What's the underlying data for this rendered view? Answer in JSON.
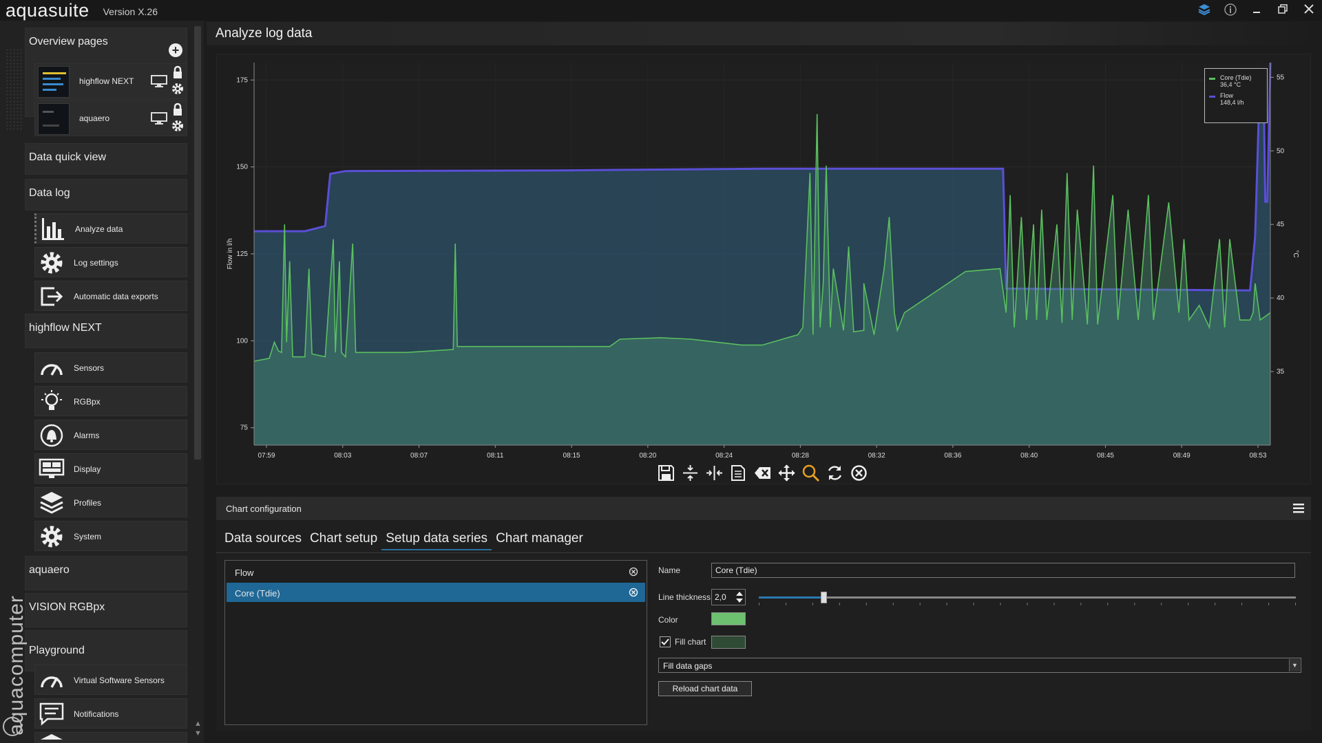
{
  "app": {
    "name": "aquasuite",
    "version": "Version X.26"
  },
  "brand": {
    "vertical": "aquacomputer"
  },
  "window_controls": {
    "layers_icon": "layers-icon",
    "info_icon": "info-icon"
  },
  "sidebar": {
    "overview_title": "Overview pages",
    "overview_pages": [
      {
        "label": "highflow NEXT"
      },
      {
        "label": "aquaero"
      }
    ],
    "data_quick_view": "Data quick view",
    "data_log": "Data log",
    "data_log_items": [
      {
        "label": "Analyze data",
        "icon": "bar-chart-icon"
      },
      {
        "label": "Log settings",
        "icon": "gear-icon"
      },
      {
        "label": "Automatic data exports",
        "icon": "export-icon"
      }
    ],
    "highflow_title": "highflow NEXT",
    "highflow_items": [
      {
        "label": "Sensors",
        "icon": "gauge-icon"
      },
      {
        "label": "RGBpx",
        "icon": "lightbulb-icon"
      },
      {
        "label": "Alarms",
        "icon": "alarm-bell-icon"
      },
      {
        "label": "Display",
        "icon": "display-icon"
      },
      {
        "label": "Profiles",
        "icon": "layers-icon"
      },
      {
        "label": "System",
        "icon": "gear-icon"
      }
    ],
    "aquaero_title": "aquaero",
    "vision_title": "VISION RGBpx",
    "playground_title": "Playground",
    "playground_items": [
      {
        "label": "Virtual Software Sensors",
        "icon": "gauge-icon"
      },
      {
        "label": "Notifications",
        "icon": "message-icon"
      }
    ]
  },
  "main": {
    "title": "Analyze log data"
  },
  "chart_data": {
    "type": "line",
    "x_ticks": [
      "07:59",
      "08:03",
      "08:07",
      "08:11",
      "08:15",
      "08:20",
      "08:24",
      "08:28",
      "08:32",
      "08:36",
      "08:40",
      "08:45",
      "08:49",
      "08:53"
    ],
    "left_axis": {
      "label": "Flow in l/h",
      "ticks": [
        75,
        100,
        125,
        150,
        175
      ],
      "range": [
        70,
        180
      ]
    },
    "right_axis": {
      "label": "°C",
      "ticks": [
        35,
        40,
        45,
        50,
        55
      ],
      "range": [
        30,
        56
      ]
    },
    "legend": [
      {
        "name": "Core (Tdie)",
        "value": "36,4 °C",
        "color": "#5bbf5f"
      },
      {
        "name": "Flow",
        "value": "148,4 l/h",
        "color": "#5a4fd6"
      }
    ],
    "series": [
      {
        "name": "Flow",
        "axis": "left",
        "color": "#5a4fd6",
        "points": [
          [
            0,
            131.5
          ],
          [
            0.05,
            131.5
          ],
          [
            0.07,
            133
          ],
          [
            0.075,
            148
          ],
          [
            0.09,
            148.8
          ],
          [
            0.3,
            149
          ],
          [
            0.5,
            149.5
          ],
          [
            0.737,
            149.5
          ],
          [
            0.74,
            115
          ],
          [
            0.98,
            114.5
          ],
          [
            0.985,
            130
          ],
          [
            0.99,
            178
          ],
          [
            0.993,
            178
          ],
          [
            0.995,
            140
          ],
          [
            0.997,
            140
          ],
          [
            1,
            180
          ]
        ]
      },
      {
        "name": "Core (Tdie)",
        "axis": "right",
        "color": "#5bbf5f",
        "points": [
          [
            0,
            35.7
          ],
          [
            0.015,
            35.9
          ],
          [
            0.02,
            37
          ],
          [
            0.024,
            36.4
          ],
          [
            0.027,
            36.3
          ],
          [
            0.03,
            45
          ],
          [
            0.032,
            37
          ],
          [
            0.035,
            42.5
          ],
          [
            0.038,
            36
          ],
          [
            0.05,
            36
          ],
          [
            0.054,
            42
          ],
          [
            0.057,
            36.2
          ],
          [
            0.07,
            36
          ],
          [
            0.078,
            44
          ],
          [
            0.08,
            36.3
          ],
          [
            0.084,
            42.5
          ],
          [
            0.086,
            36.3
          ],
          [
            0.09,
            36
          ],
          [
            0.097,
            43.7
          ],
          [
            0.1,
            36.3
          ],
          [
            0.12,
            36.3
          ],
          [
            0.15,
            36.3
          ],
          [
            0.196,
            36.5
          ],
          [
            0.198,
            43.7
          ],
          [
            0.2,
            36.7
          ],
          [
            0.22,
            36.7
          ],
          [
            0.3,
            36.7
          ],
          [
            0.35,
            36.7
          ],
          [
            0.36,
            37.2
          ],
          [
            0.4,
            37.3
          ],
          [
            0.43,
            37.2
          ],
          [
            0.48,
            36.8
          ],
          [
            0.5,
            36.8
          ],
          [
            0.52,
            37.2
          ],
          [
            0.535,
            37.5
          ],
          [
            0.54,
            38
          ],
          [
            0.547,
            48.5
          ],
          [
            0.55,
            37.5
          ],
          [
            0.554,
            52.5
          ],
          [
            0.557,
            38
          ],
          [
            0.56,
            41
          ],
          [
            0.563,
            49
          ],
          [
            0.567,
            38
          ],
          [
            0.57,
            42
          ],
          [
            0.58,
            37.8
          ],
          [
            0.585,
            43.5
          ],
          [
            0.59,
            37.7
          ],
          [
            0.6,
            37.8
          ],
          [
            0.6,
            41
          ],
          [
            0.61,
            37.5
          ],
          [
            0.62,
            42
          ],
          [
            0.625,
            45.5
          ],
          [
            0.63,
            39
          ],
          [
            0.633,
            37.8
          ],
          [
            0.64,
            39
          ],
          [
            0.7,
            41.8
          ],
          [
            0.734,
            42
          ],
          [
            0.74,
            39
          ],
          [
            0.744,
            47
          ],
          [
            0.748,
            38
          ],
          [
            0.755,
            45.5
          ],
          [
            0.76,
            38.5
          ],
          [
            0.767,
            45
          ],
          [
            0.77,
            38.5
          ],
          [
            0.775,
            46
          ],
          [
            0.78,
            38.5
          ],
          [
            0.79,
            45
          ],
          [
            0.795,
            38.3
          ],
          [
            0.8,
            48.5
          ],
          [
            0.805,
            38.5
          ],
          [
            0.81,
            46
          ],
          [
            0.82,
            38.2
          ],
          [
            0.826,
            49
          ],
          [
            0.83,
            38.2
          ],
          [
            0.845,
            47
          ],
          [
            0.85,
            38.5
          ],
          [
            0.86,
            46
          ],
          [
            0.87,
            38.5
          ],
          [
            0.88,
            47
          ],
          [
            0.885,
            38.5
          ],
          [
            0.9,
            46.5
          ],
          [
            0.91,
            39
          ],
          [
            0.915,
            44
          ],
          [
            0.92,
            38.5
          ],
          [
            0.93,
            39.5
          ],
          [
            0.94,
            38
          ],
          [
            0.95,
            44
          ],
          [
            0.955,
            38
          ],
          [
            0.96,
            44
          ],
          [
            0.97,
            38.5
          ],
          [
            0.98,
            38.5
          ],
          [
            0.983,
            39
          ],
          [
            0.985,
            41
          ],
          [
            0.99,
            38.5
          ],
          [
            1,
            39
          ]
        ]
      }
    ]
  },
  "toolbar": [
    "save-icon",
    "fit-vertical-icon",
    "fit-horizontal-icon",
    "export-icon",
    "clear-icon",
    "move-icon",
    "zoom-icon",
    "refresh-icon",
    "close-icon"
  ],
  "config": {
    "title": "Chart configuration",
    "tabs": [
      "Data sources",
      "Chart setup",
      "Setup data series",
      "Chart manager"
    ],
    "active_tab": "Setup data series",
    "series_list": [
      "Flow",
      "Core (Tdie)"
    ],
    "selected_series": "Core (Tdie)",
    "name_label": "Name",
    "name_value": "Core (Tdie)",
    "thickness_label": "Line thickness",
    "thickness_value": "2,0",
    "thickness_fraction": 0.12,
    "color_label": "Color",
    "line_color": "#6dc06f",
    "fill_label": "Fill chart",
    "fill_checked": true,
    "fill_color": "#2f4a35",
    "gap_option": "Fill data gaps",
    "reload_label": "Reload chart data"
  }
}
